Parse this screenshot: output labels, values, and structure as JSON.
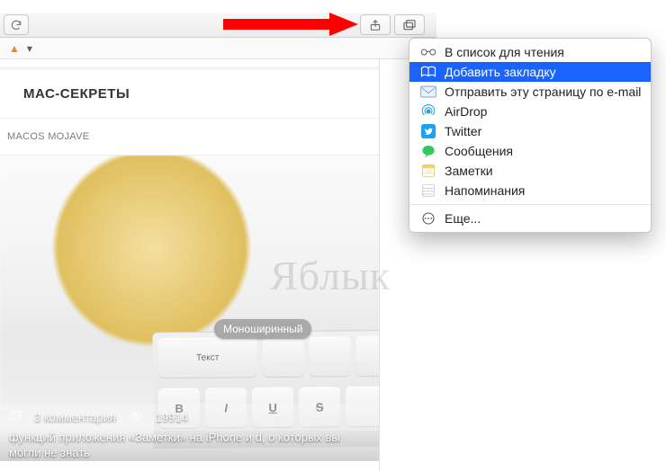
{
  "colors": {
    "arrow": "#ff0000",
    "selection": "#1a63ff",
    "twitter": "#1da1f2",
    "airdrop": "#2ea0df",
    "mail": "#5aa0e6"
  },
  "toolbar": {
    "reload_label": "Reload",
    "share_label": "Share",
    "tabs_label": "Show Tabs"
  },
  "bookmark_bar": {
    "item_label": "",
    "dropdown_glyph": "▾"
  },
  "page": {
    "heading": "МАС-СЕКРЕТЫ",
    "subnav": "MACOS MOJAVE"
  },
  "article": {
    "keyboard_pill": "Моноширинный",
    "key_text_label": "Текст",
    "keys_row2": [
      "B",
      "I",
      "U",
      "S"
    ],
    "comments_count": "3 комментария",
    "views_count": "19914",
    "title_line": "функций приложения «Заметки» на iPhone и d, о которых вы могли не знать"
  },
  "watermark": "Яблык",
  "share_menu": {
    "items": [
      {
        "id": "reading-list",
        "label": "В список для чтения",
        "icon": "glasses",
        "selected": false
      },
      {
        "id": "add-bookmark",
        "label": "Добавить закладку",
        "icon": "book",
        "selected": true
      },
      {
        "id": "email-page",
        "label": "Отправить эту страницу по e-mail",
        "icon": "mail",
        "selected": false
      },
      {
        "id": "airdrop",
        "label": "AirDrop",
        "icon": "airdrop",
        "selected": false
      },
      {
        "id": "twitter",
        "label": "Twitter",
        "icon": "twitter",
        "selected": false
      },
      {
        "id": "messages",
        "label": "Сообщения",
        "icon": "messages",
        "selected": false
      },
      {
        "id": "notes",
        "label": "Заметки",
        "icon": "notes",
        "selected": false
      },
      {
        "id": "reminders",
        "label": "Напоминания",
        "icon": "reminders",
        "selected": false
      }
    ],
    "more_label": "Еще..."
  }
}
